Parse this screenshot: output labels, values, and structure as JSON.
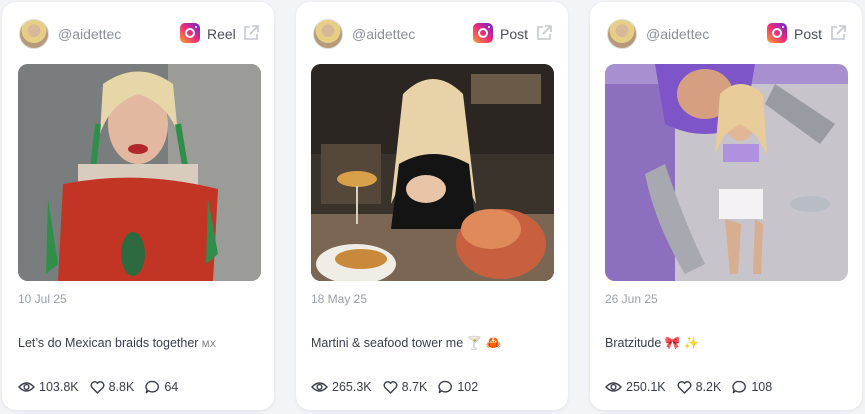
{
  "colors": {
    "card_bg": "#ffffff",
    "page_bg": "#f3f4f8",
    "muted_text": "#9a9fad",
    "text": "#3a3e4a"
  },
  "posts": [
    {
      "handle": "@aidettec",
      "platform_icon": "instagram-icon",
      "type": "Reel",
      "date": "10 Jul 25",
      "caption": "Let’s do Mexican braids together",
      "caption_suffix": "MX",
      "views": "103.8K",
      "likes": "8.8K",
      "comments": "64"
    },
    {
      "handle": "@aidettec",
      "platform_icon": "instagram-icon",
      "type": "Post",
      "date": "18 May 25",
      "caption": "Martini & seafood tower me 🍸 🦀",
      "views": "265.3K",
      "likes": "8.7K",
      "comments": "102"
    },
    {
      "handle": "@aidettec",
      "platform_icon": "instagram-icon",
      "type": "Post",
      "date": "26 Jun 25",
      "caption": "Bratzitude 🎀 ✨",
      "views": "250.1K",
      "likes": "8.2K",
      "comments": "108"
    }
  ]
}
